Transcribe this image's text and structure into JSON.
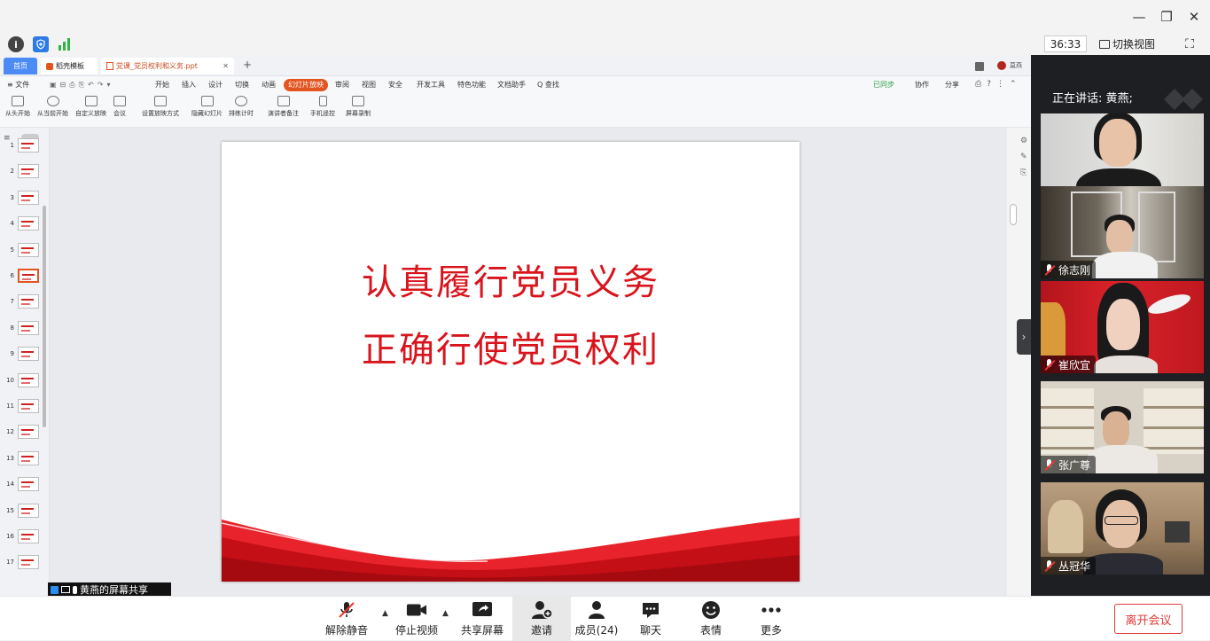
{
  "window": {
    "minimize": "—",
    "restore": "❐",
    "close": "✕"
  },
  "topbar": {
    "info_icon": "i",
    "timer": "36:33",
    "switch_view": "切换视图"
  },
  "wps": {
    "tabs": [
      "首页",
      "稻壳模板",
      "党课_党员权利和义务.ppt"
    ],
    "new_tab": "+",
    "account": "莫燕",
    "menu": [
      "≡ 文件",
      "开始",
      "插入",
      "设计",
      "切换",
      "动画",
      "幻灯片放映",
      "审阅",
      "视图",
      "安全",
      "开发工具",
      "特色功能",
      "文档助手",
      "Q 查找"
    ],
    "menu_right": [
      "已同步",
      "协作",
      "分享"
    ],
    "ribbon": [
      "从头开始",
      "从当前开始",
      "自定义放映",
      "会议",
      "设置放映方式",
      "隐藏幻灯片",
      "排练计时",
      "演讲者备注",
      "手机遥控",
      "屏幕录制"
    ],
    "slide_numbers": [
      "1",
      "2",
      "3",
      "4",
      "5",
      "6",
      "7",
      "8",
      "9",
      "10",
      "11",
      "12",
      "13",
      "14",
      "15",
      "16",
      "17"
    ],
    "slide": {
      "line1": "认真履行党员义务",
      "line2": "正确行使党员权利"
    }
  },
  "share_label": "黄燕的屏幕共享",
  "panel": {
    "speaking": "正在讲话: 黄燕;",
    "participants": [
      {
        "name": "黄燕"
      },
      {
        "name": "徐志刚"
      },
      {
        "name": "崔欣宜"
      },
      {
        "name": "张广尊"
      },
      {
        "name": "丛冠华"
      }
    ]
  },
  "toolbar": {
    "unmute": "解除静音",
    "stop_video": "停止视频",
    "share": "共享屏幕",
    "invite": "邀请",
    "members": "成员(24)",
    "chat": "聊天",
    "emoji": "表情",
    "more": "更多",
    "leave": "离开会议"
  },
  "colors": {
    "accent": "#e4541f",
    "slide_red": "#d9141c",
    "leave": "#e03a3a",
    "panel_bg": "#1e1f22"
  }
}
